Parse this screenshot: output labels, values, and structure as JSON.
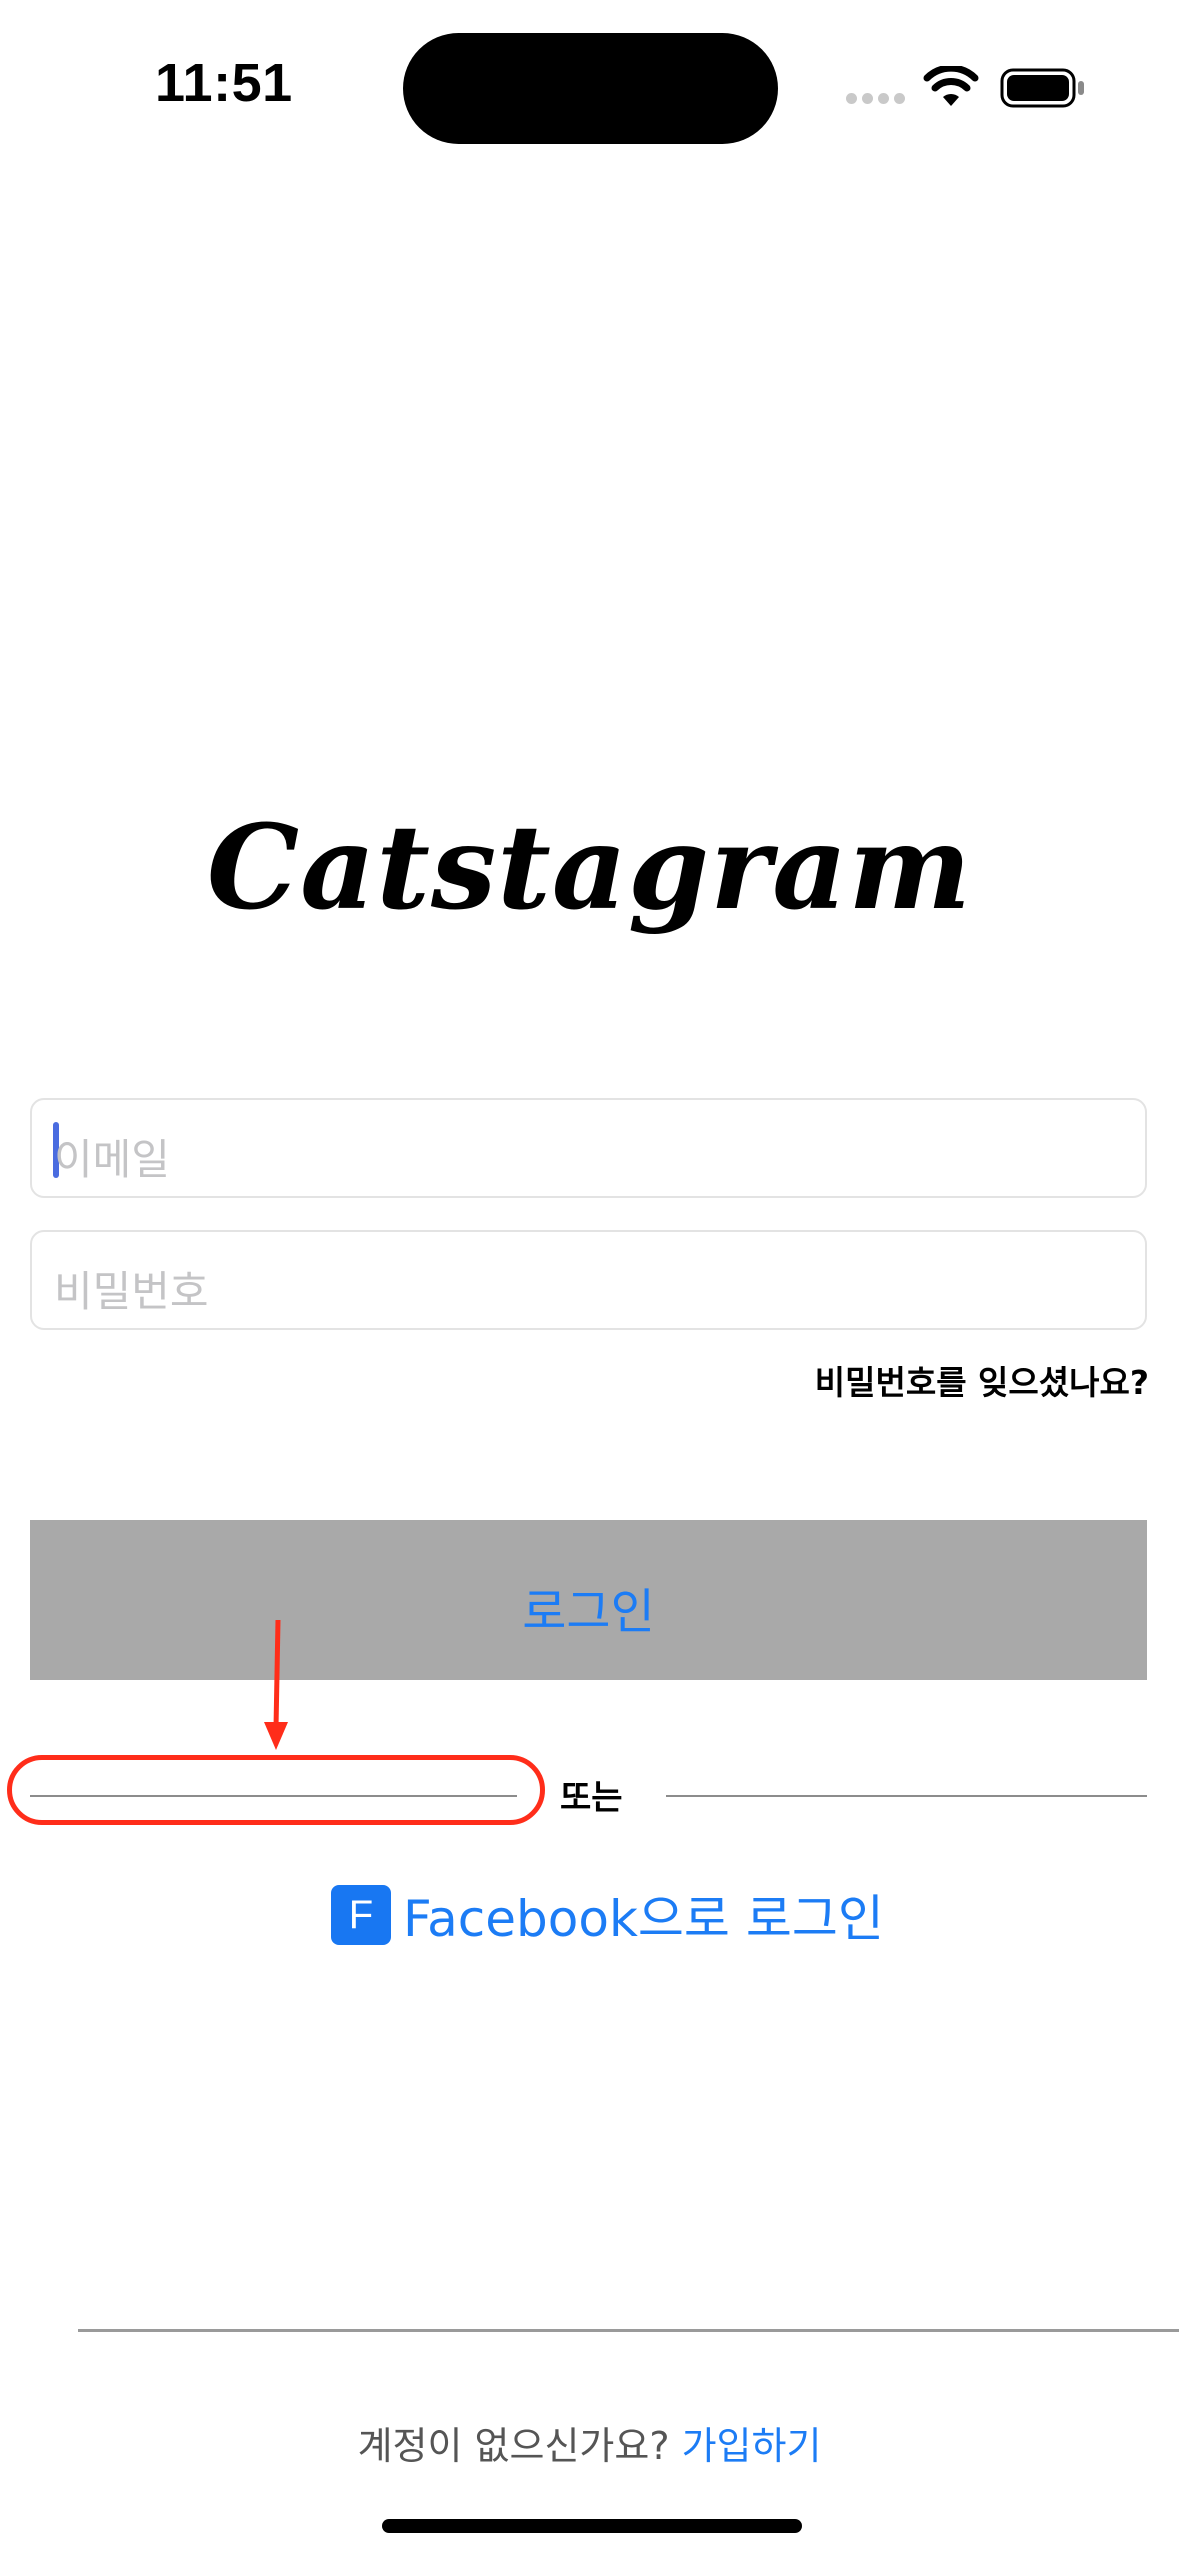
{
  "status_bar": {
    "time": "11:51"
  },
  "logo": {
    "text": "Catstagram"
  },
  "email_field": {
    "placeholder": "이메일",
    "value": ""
  },
  "password_field": {
    "placeholder": "비밀번호",
    "value": ""
  },
  "forgot_password": {
    "label": "비밀번호를 잊으셨나요?"
  },
  "login_button": {
    "label": "로그인"
  },
  "divider": {
    "label": "또는"
  },
  "facebook_login": {
    "icon_letter": "F",
    "label": "Facebook으로 로그인"
  },
  "signup": {
    "prompt": "계정이 없으신가요?",
    "link": "가입하기"
  },
  "colors": {
    "accent_blue": "#1c7cf5",
    "login_button_bg": "#a9a9a9",
    "annotation_red": "#ff2d1a"
  },
  "icons": [
    "signal-dots-icon",
    "wifi-icon",
    "battery-icon",
    "facebook-icon"
  ]
}
